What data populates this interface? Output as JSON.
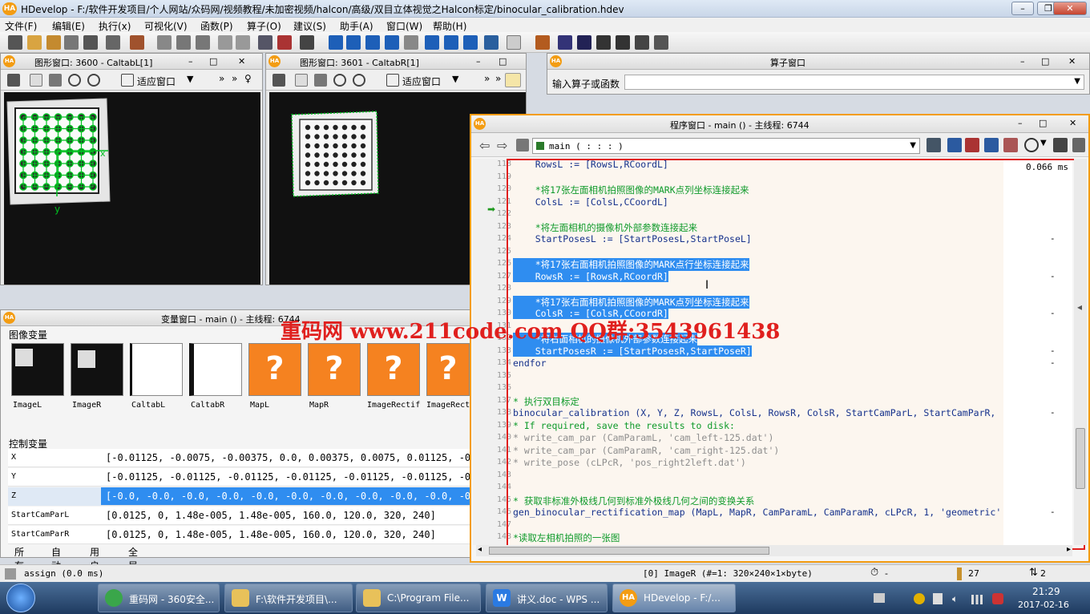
{
  "app": {
    "title": "HDevelop - F:/软件开发项目/个人网站/众码网/视频教程/未加密视频/halcon/高级/双目立体视觉之Halcon标定/binocular_calibration.hdev",
    "logo": "HA"
  },
  "menu": [
    "文件(F)",
    "编辑(E)",
    "执行(x)",
    "可视化(V)",
    "函数(P)",
    "算子(O)",
    "建议(S)",
    "助手(A)",
    "窗口(W)",
    "帮助(H)"
  ],
  "graphics_left": {
    "title": "图形窗口: 3600 - CaltabL[1]",
    "fit_label": "适应窗口",
    "axis_x": "x",
    "axis_y": "y"
  },
  "graphics_right": {
    "title": "图形窗口: 3601 - CaltabR[1]",
    "fit_label": "适应窗口"
  },
  "operator_window": {
    "title": "算子窗口",
    "input_label": "输入算子或函数"
  },
  "variable_window": {
    "title": "变量窗口 - main () - 主线程: 6744",
    "iconic_label": "图像变量",
    "iconic": [
      "ImageL",
      "ImageR",
      "CaltabL",
      "CaltabR",
      "MapL",
      "MapR",
      "ImageRectif",
      "ImageRect"
    ],
    "control_label": "控制变量",
    "controls": [
      {
        "name": "X",
        "value": "[-0.01125, -0.0075, -0.00375, 0.0, 0.00375, 0.0075, 0.01125, -0.01"
      },
      {
        "name": "Y",
        "value": "[-0.01125, -0.01125, -0.01125, -0.01125, -0.01125, -0.01125, -0.01"
      },
      {
        "name": "Z",
        "value": "[-0.0, -0.0, -0.0, -0.0, -0.0, -0.0, -0.0, -0.0, -0.0, -0.0, -0.0,"
      },
      {
        "name": "StartCamParL",
        "value": "[0.0125, 0, 1.48e-005, 1.48e-005, 160.0, 120.0, 320, 240]"
      },
      {
        "name": "StartCamParR",
        "value": "[0.0125, 0, 1.48e-005, 1.48e-005, 160.0, 120.0, 320, 240]"
      }
    ],
    "tabs": [
      "所有",
      "自动",
      "用户",
      "全局"
    ]
  },
  "program_window": {
    "title": "程序窗口 - main () - 主线程: 6744",
    "procedure": "main ( : : : )",
    "timing": "0.066 ms",
    "lines": [
      {
        "n": "118",
        "text": "    RowsL := [RowsL,RCoordL]",
        "cls": "blue",
        "sel": false
      },
      {
        "n": "119",
        "text": "",
        "cls": "",
        "sel": false
      },
      {
        "n": "120",
        "text": "    *将17张左面相机拍照图像的MARK点列坐标连接起来",
        "cls": "green",
        "sel": false
      },
      {
        "n": "121",
        "text": "    ColsL := [ColsL,CCoordL]",
        "cls": "blue",
        "sel": false
      },
      {
        "n": "122",
        "text": "",
        "cls": "",
        "sel": false
      },
      {
        "n": "123",
        "text": "    *将左面相机的摄像机外部参数连接起来",
        "cls": "green",
        "sel": false
      },
      {
        "n": "124",
        "text": "    StartPosesL := [StartPosesL,StartPoseL]",
        "cls": "blue",
        "sel": false
      },
      {
        "n": "125",
        "text": "",
        "cls": "",
        "sel": false
      },
      {
        "n": "126",
        "text": "    *将17张右面相机拍照图像的MARK点行坐标连接起来",
        "cls": "green",
        "sel": true
      },
      {
        "n": "127",
        "text": "    RowsR := [RowsR,RCoordR]",
        "cls": "blue",
        "sel": true
      },
      {
        "n": "128",
        "text": "",
        "cls": "",
        "sel": false
      },
      {
        "n": "129",
        "text": "    *将17张右面相机拍照图像的MARK点列坐标连接起来",
        "cls": "green",
        "sel": true
      },
      {
        "n": "130",
        "text": "    ColsR := [ColsR,CCoordR]",
        "cls": "blue",
        "sel": true
      },
      {
        "n": "131",
        "text": "",
        "cls": "",
        "sel": false
      },
      {
        "n": "132",
        "text": "    *将右面相机的摄像机外部参数连接起来",
        "cls": "green",
        "sel": true
      },
      {
        "n": "133",
        "text": "    StartPosesR := [StartPosesR,StartPoseR]",
        "cls": "blue",
        "sel": true
      },
      {
        "n": "134",
        "text": "endfor",
        "cls": "blue",
        "sel": false
      },
      {
        "n": "135",
        "text": "",
        "cls": "",
        "sel": false
      },
      {
        "n": "136",
        "text": "",
        "cls": "",
        "sel": false
      },
      {
        "n": "137",
        "text": "* 执行双目标定",
        "cls": "green",
        "sel": false
      },
      {
        "n": "138",
        "text": "binocular_calibration (X, Y, Z, RowsL, ColsL, RowsR, ColsR, StartCamParL, StartCamParR,",
        "cls": "blue",
        "sel": false
      },
      {
        "n": "139",
        "text": "* If required, save the results to disk:",
        "cls": "green",
        "sel": false
      },
      {
        "n": "140",
        "text": "* write_cam_par (CamParamL, 'cam_left-125.dat')",
        "cls": "gray",
        "sel": false
      },
      {
        "n": "141",
        "text": "* write_cam_par (CamParamR, 'cam_right-125.dat')",
        "cls": "gray",
        "sel": false
      },
      {
        "n": "142",
        "text": "* write_pose (cLPcR, 'pos_right2left.dat')",
        "cls": "gray",
        "sel": false
      },
      {
        "n": "143",
        "text": "",
        "cls": "",
        "sel": false
      },
      {
        "n": "144",
        "text": "",
        "cls": "",
        "sel": false
      },
      {
        "n": "145",
        "text": "* 获取非标准外极线几何到标准外极线几何之间的变换关系",
        "cls": "green",
        "sel": false
      },
      {
        "n": "146",
        "text": "gen_binocular_rectification_map (MapL, MapR, CamParamL, CamParamR, cLPcR, 1, 'geometric'",
        "cls": "blue",
        "sel": false
      },
      {
        "n": "147",
        "text": "",
        "cls": "",
        "sel": false
      },
      {
        "n": "148",
        "text": "*读取左相机拍照的一张图",
        "cls": "green",
        "sel": false
      }
    ],
    "dashes": [
      "",
      "-",
      "",
      "-",
      "-",
      "-",
      "-",
      "-",
      "-",
      "-",
      "-",
      "-",
      "-"
    ]
  },
  "watermark": "重码网 www.211code.com  QQ群:3543961438",
  "status": {
    "left": "assign (0.0 ms)",
    "image": "[0] ImageR (#=1: 320×240×1×byte)",
    "timer": "-",
    "count": "27",
    "extra": "2"
  },
  "taskbar": {
    "items": [
      "重码网 - 360安全...",
      "F:\\软件开发项目\\...",
      "C:\\Program File...",
      "讲义.doc - WPS ...",
      "HDevelop - F:/..."
    ],
    "time": "21:29",
    "date": "2017-02-16"
  },
  "colors": {
    "accent": "#f39c12",
    "selection": "#2f8df0",
    "red_frame": "#e0201e",
    "watermark": "#e0201e"
  }
}
